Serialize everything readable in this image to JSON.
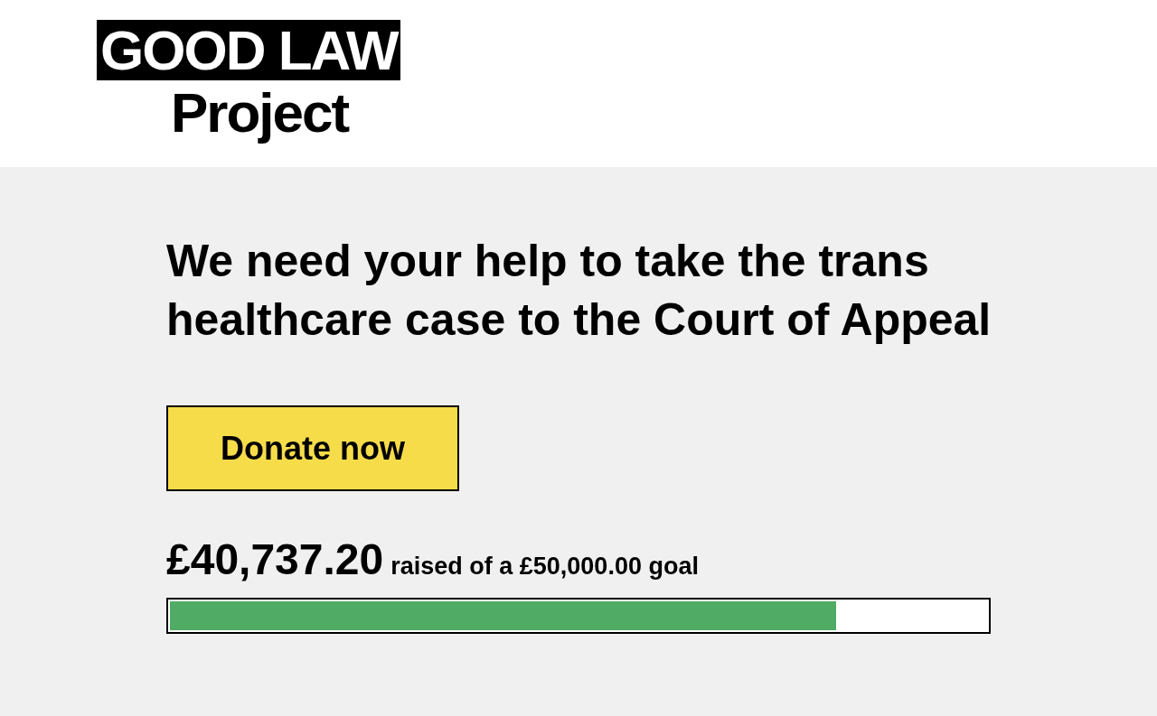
{
  "logo": {
    "top": "GOOD LAW",
    "bottom": "Project"
  },
  "heading": "We need your help to take the trans healthcare case to the Court of Appeal",
  "donate_button": "Donate now",
  "fundraiser": {
    "raised": "£40,737.20",
    "goal_text": "raised of a £50,000.00 goal",
    "level": 0.815
  }
}
